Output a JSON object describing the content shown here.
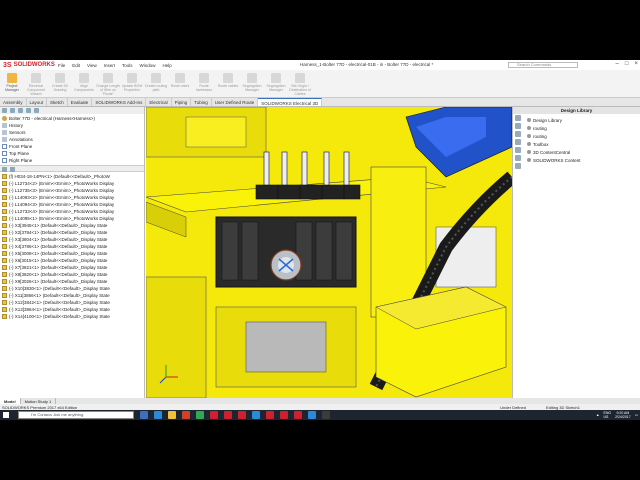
{
  "app": {
    "logo_text": "SOLIDWORKS",
    "menu": [
      "File",
      "Edit",
      "View",
      "Insert",
      "Tools",
      "Window",
      "Help"
    ],
    "doc_title": "Harness_1-Bolter 77D - electrical-01B - in - Bolter 77D - electrical *",
    "search_placeholder": "Search Commands"
  },
  "ribbon": {
    "buttons": [
      {
        "label": "Project Manager",
        "active": true
      },
      {
        "label": "Electrical Component Wizard",
        "active": false
      },
      {
        "label": "Create 3D Drawing",
        "active": false
      },
      {
        "label": "Align Components",
        "active": false
      },
      {
        "label": "Change Length of Wire on \"Route\"",
        "active": false
      },
      {
        "label": "Update BOM Properties",
        "active": false
      },
      {
        "label": "Create routing path",
        "active": false
      },
      {
        "label": "Route wires",
        "active": false
      },
      {
        "label": "Route harnesses",
        "active": false
      },
      {
        "label": "Route cables",
        "active": false
      },
      {
        "label": "Segregation Manager",
        "active": false
      },
      {
        "label": "Segregation Manager",
        "active": false
      },
      {
        "label": "Set Origin / Destination of Cables",
        "active": false
      }
    ]
  },
  "command_tabs": [
    "Assembly",
    "Layout",
    "Sketch",
    "Evaluate",
    "SOLIDWORKS Add-Ins",
    "Electrical",
    "Piping",
    "Tubing",
    "User Defined Route",
    "SOLIDWORKS Electrical 3D"
  ],
  "command_tab_active": "SOLIDWORKS Electrical 3D",
  "feature_tree": {
    "top": [
      {
        "label": "Bolter 77D - electrical  (Harness<Harness>)",
        "icon": "part"
      },
      {
        "label": "History",
        "icon": "hist"
      },
      {
        "label": "Sensors",
        "icon": "hist"
      },
      {
        "label": "Annotations",
        "icon": "hist"
      },
      {
        "label": "Front Plane",
        "icon": "plane"
      },
      {
        "label": "Top Plane",
        "icon": "plane"
      },
      {
        "label": "Right Plane",
        "icon": "plane"
      }
    ],
    "components": [
      "(f) H034-18-14PN<1> (Default<<Default>_PhotoW",
      "(-) L12734<2> (Emim<<Emim>_PhotoWorks Display",
      "(-) L12735<3> (Emim<<Emim>_PhotoWorks Display",
      "(-) L14093<2> (Emim<<Emim>_PhotoWorks Display",
      "(-) L14094<3> (Emim<<Emim>_PhotoWorks Display",
      "(-) L12733<4> (Emim<<Emim>_PhotoWorks Display",
      "(-) L14095<1> (Emim<<Emim>_PhotoWorks Display",
      "(-) X3[3945<1> (Default<<Default>_Display State",
      "(-) X2[3784<1> (Default<<Default>_Display State",
      "(-) X3[3804<1> (Default<<Default>_Display State",
      "(-) X4[3786<1> (Default<<Default>_Display State",
      "(-) X5[3008<1> (Default<<Default>_Display State",
      "(-) X6[3015<1> (Default<<Default>_Display State",
      "(-) X7[3821<1> (Default<<Default>_Display State",
      "(-) X8[3820<1> (Default<<Default>_Display State",
      "(-) X9[3026<1> (Default<<Default>_Display State",
      "(-) X10[3830<1> (Default<<Default>_Display State",
      "(-) X11[3866<1> (Default<<Default>_Display State",
      "(-) X12[3842<1> (Default<<Default>_Display State",
      "(-) X13[3864<1> (Default<<Default>_Display State",
      "(-) X14[4100<1> (Default<<Default>_Display State"
    ]
  },
  "design_library": {
    "title": "Design Library",
    "items": [
      "Design Library",
      "routing",
      "routing",
      "Toolbox",
      "3D ContentCentral",
      "SOLIDWORKS Content"
    ]
  },
  "bottom_tabs": [
    "Model",
    "Motion Study 1"
  ],
  "status": {
    "left": "SOLIDWORKS Premium 2017 x64 Edition",
    "mid": "Under Defined",
    "right": "Editing 3D Sketch1"
  },
  "taskbar": {
    "cortana": "I'm Cortana. Ask me anything.",
    "lang": "ENG",
    "region": "US",
    "time": "9:20 AM",
    "date": "2/24/2017",
    "apps": [
      "#3b6fbf",
      "#2b8ad8",
      "#f0c23a",
      "#d0402b",
      "#33a852",
      "#cf2030",
      "#cf2030",
      "#cf2030",
      "#2b8ad8",
      "#cf2030",
      "#cf2030",
      "#cf2030",
      "#2b8ad8",
      "#3b3b3b"
    ]
  }
}
